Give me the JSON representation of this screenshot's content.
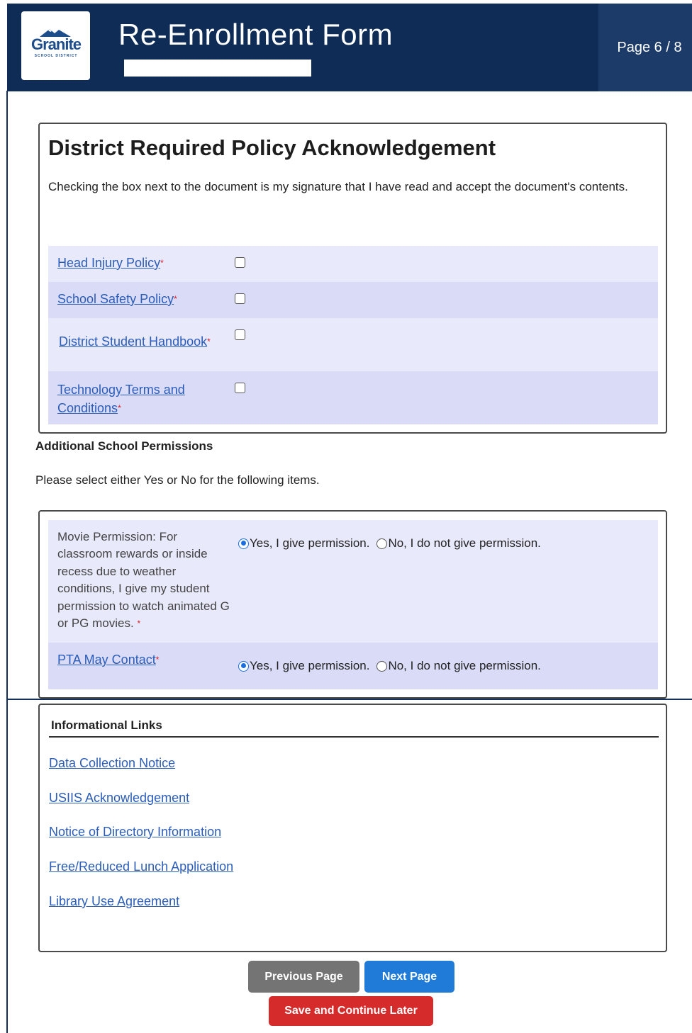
{
  "header": {
    "logo_text": "Granite",
    "logo_subtext": "SCHOOL DISTRICT",
    "title": "Re-Enrollment Form",
    "page_indicator": "Page 6 / 8"
  },
  "policies": {
    "heading": "District Required Policy Acknowledgement",
    "description": "Checking the box next to the document is my signature that I have read and accept the document's contents.",
    "required_mark": "*",
    "items": [
      {
        "label": "Head Injury Policy",
        "checked": false
      },
      {
        "label": "School Safety Policy",
        "checked": false
      },
      {
        "label": "District Student Handbook",
        "checked": false
      },
      {
        "label": "Technology Terms and Conditions",
        "checked": false
      }
    ]
  },
  "permissions": {
    "title": "Additional School Permissions",
    "description": "Please select either Yes or No for the following items.",
    "yes_label": "Yes, I give permission.",
    "no_label": "No, I do not give permission.",
    "items": [
      {
        "label": "Movie Permission: For classroom rewards or inside recess due to weather conditions, I give my student permission to watch animated G or PG movies.",
        "selected": "yes"
      },
      {
        "label": "PTA May Contact",
        "selected": "yes"
      }
    ]
  },
  "info_links": {
    "title": "Informational Links",
    "links": [
      "Data Collection Notice",
      "USIIS Acknowledgement",
      "Notice of Directory Information",
      "Free/Reduced Lunch Application",
      "Library Use Agreement"
    ]
  },
  "buttons": {
    "previous": "Previous Page",
    "next": "Next Page",
    "save": "Save and Continue Later"
  },
  "colors": {
    "header_bg": "#0f2c56",
    "link": "#2b5db8",
    "required": "#d8202a",
    "next_button": "#1f7ad8",
    "save_button": "#d62b2b",
    "previous_button": "#747474"
  }
}
